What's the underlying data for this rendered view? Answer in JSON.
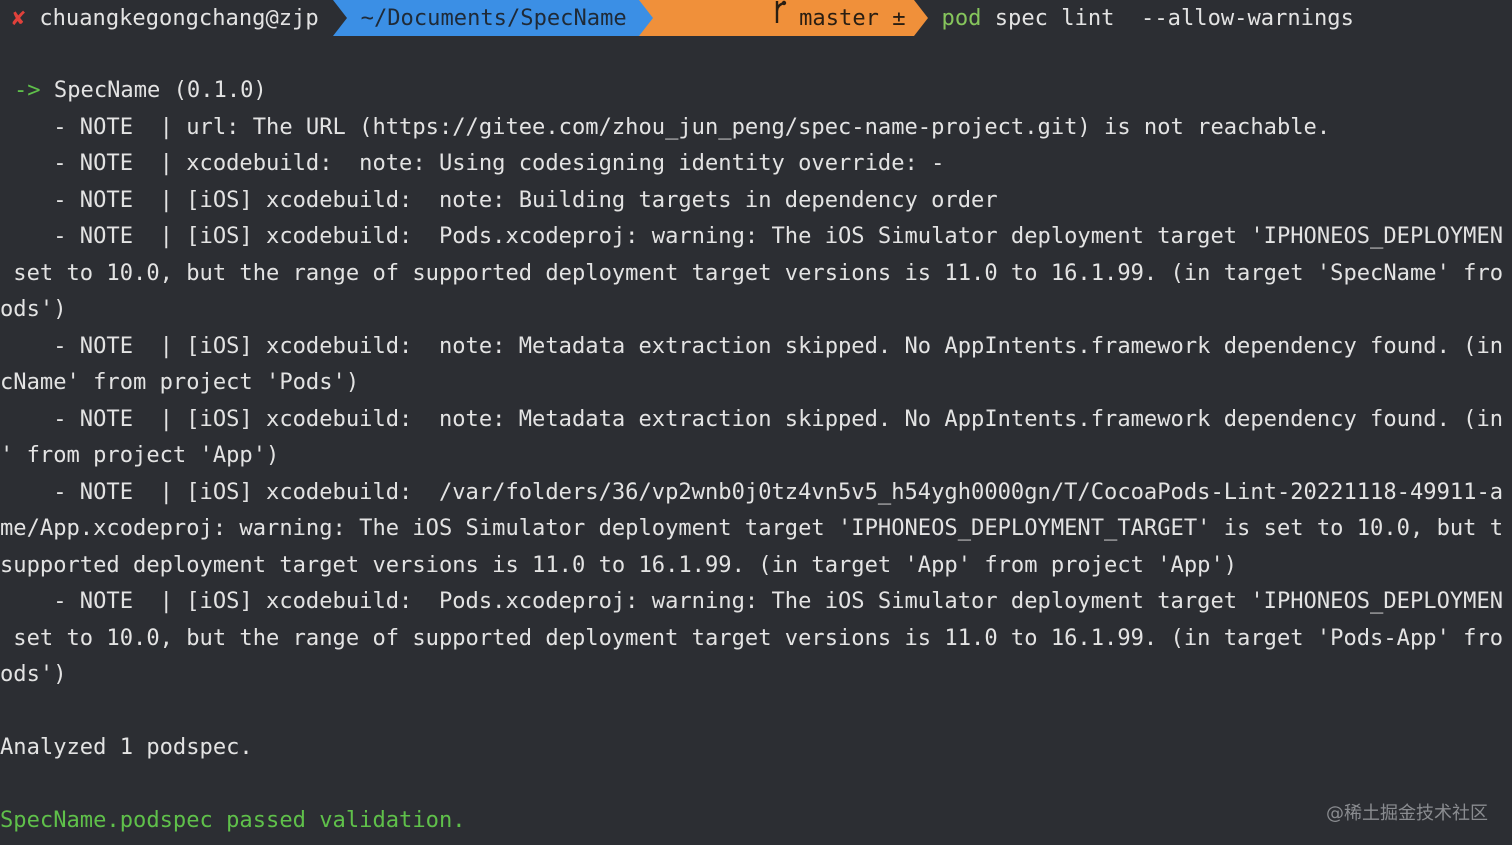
{
  "prompt": {
    "status_icon": "✘",
    "context": "chuangkegongchang@zjp",
    "directory": "~/Documents/SpecName",
    "branch_icon": "git-branch-icon",
    "branch": "master ±",
    "command_pod": "pod",
    "command_rest": " spec lint  --allow-warnings"
  },
  "colors": {
    "background": "#2c2e33",
    "dir_segment": "#3b8fe5",
    "git_segment": "#f0903a",
    "success": "#5fc04a",
    "error": "#e0413b"
  },
  "output": {
    "spec_arrow": "->",
    "spec_header": " SpecName (0.1.0)",
    "lines": [
      "    - NOTE  | url: The URL (https://gitee.com/zhou_jun_peng/spec-name-project.git) is not reachable.",
      "    - NOTE  | xcodebuild:  note: Using codesigning identity override: -",
      "    - NOTE  | [iOS] xcodebuild:  note: Building targets in dependency order",
      "    - NOTE  | [iOS] xcodebuild:  Pods.xcodeproj: warning: The iOS Simulator deployment target 'IPHONEOS_DEPLOYMEN",
      " set to 10.0, but the range of supported deployment target versions is 11.0 to 16.1.99. (in target 'SpecName' fro",
      "ods')",
      "    - NOTE  | [iOS] xcodebuild:  note: Metadata extraction skipped. No AppIntents.framework dependency found. (in",
      "cName' from project 'Pods')",
      "    - NOTE  | [iOS] xcodebuild:  note: Metadata extraction skipped. No AppIntents.framework dependency found. (in",
      "' from project 'App')",
      "    - NOTE  | [iOS] xcodebuild:  /var/folders/36/vp2wnb0j0tz4vn5v5_h54ygh0000gn/T/CocoaPods-Lint-20221118-49911-a",
      "me/App.xcodeproj: warning: The iOS Simulator deployment target 'IPHONEOS_DEPLOYMENT_TARGET' is set to 10.0, but t",
      "supported deployment target versions is 11.0 to 16.1.99. (in target 'App' from project 'App')",
      "    - NOTE  | [iOS] xcodebuild:  Pods.xcodeproj: warning: The iOS Simulator deployment target 'IPHONEOS_DEPLOYMEN",
      " set to 10.0, but the range of supported deployment target versions is 11.0 to 16.1.99. (in target 'Pods-App' fro",
      "ods')"
    ],
    "summary": "Analyzed 1 podspec.",
    "result": "SpecName.podspec passed validation."
  },
  "watermark": "@稀土掘金技术社区"
}
